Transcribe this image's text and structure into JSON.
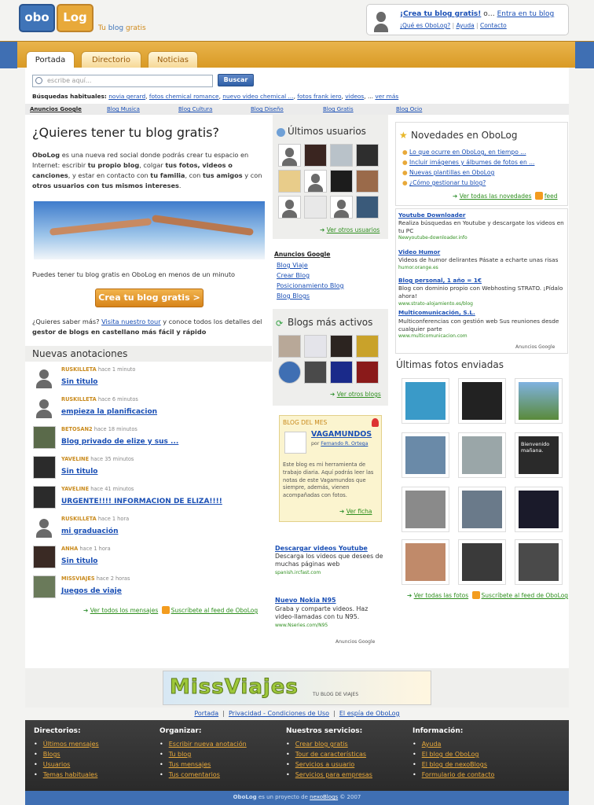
{
  "header": {
    "logo_left": "obo",
    "logo_right": "Log",
    "tagline_pre": "Tu ",
    "tagline_mid": "blog",
    "tagline_post": " gratis",
    "login": {
      "create": "¡Crea tu blog gratis!",
      "or": " o… ",
      "enter": "Entra en tu blog",
      "what": "¡Qué es OboLog?",
      "help": "Ayuda",
      "contact": "Contacto"
    }
  },
  "tabs": [
    "Portada",
    "Directorio",
    "Noticias"
  ],
  "search": {
    "placeholder": "escribe aquí...",
    "button": "Buscar",
    "label": "Búsquedas habituales:",
    "links": [
      "novia gerard",
      "fotos chemical romance",
      "nuevo video chemical ...",
      "fotos frank iero",
      "videos"
    ],
    "sep": ", ... ",
    "more": "ver más"
  },
  "adsbar": {
    "label": "Anuncios Google",
    "links": [
      "Blog Musica",
      "Blog Cultura",
      "Blog Diseño",
      "Blog Gratis",
      "Blog Ocio"
    ]
  },
  "intro": {
    "title": "¿Quieres tener tu blog gratis?",
    "p1a": "OboLog",
    "p1b": " es una nueva red social donde podrás crear tu espacio en Internet: escribir ",
    "p1c": "tu propio blog",
    "p1d": ", colgar ",
    "p1e": "tus fotos, videos o canciones",
    "p1f": ", y estar en contacto con ",
    "p1g": "tu familia",
    "p1h": ", con ",
    "p1i": "tus amigos",
    "p1j": " y con ",
    "p1k": "otros usuarios con tus mismos intereses",
    "p1l": ".",
    "p2": "Puedes tener tu blog gratis en OboLog en menos de un minuto",
    "cta": "Crea tu blog gratis >",
    "p3a": "¿Quieres saber más? ",
    "p3b": "Visita nuestro tour",
    "p3c": " y conoce todos los detalles del ",
    "p3d": "gestor de blogs en castellano más fácil y rápido"
  },
  "annotations": {
    "title": "Nuevas anotaciones",
    "items": [
      {
        "user": "RUSKILLETA",
        "time": "hace 1 minuto",
        "title": "Sin titulo"
      },
      {
        "user": "RUSKILLETA",
        "time": "hace 6 minutos",
        "title": "empieza la planificacion"
      },
      {
        "user": "BETOSAN2",
        "time": "hace 18 minutos",
        "title": "Blog privado de elize y sus ..."
      },
      {
        "user": "YAVELINE",
        "time": "hace 35 minutos",
        "title": "Sin titulo"
      },
      {
        "user": "YAVELINE",
        "time": "hace 41 minutos",
        "title": "URGENTE!!!! INFORMACION DE ELIZA!!!!"
      },
      {
        "user": "RUSKILLETA",
        "time": "hace 1 hora",
        "title": "mi graduación"
      },
      {
        "user": "ANHA",
        "time": "hace 1 hora",
        "title": "Sin titulo"
      },
      {
        "user": "MISSVIAJES",
        "time": "hace 2 horas",
        "title": "Juegos de viaje"
      }
    ],
    "all": "Ver todos los mensajes",
    "feed": "Suscríbete al feed de OboLog"
  },
  "users": {
    "title": "Últimos usuarios",
    "more": "Ver otros usuarios"
  },
  "ads_mid": {
    "label": "Anuncios Google",
    "links": [
      "Blog Viaje",
      "Crear Blog",
      "Posicionamiento Blog",
      "Blog Blogs"
    ]
  },
  "active": {
    "title": "Blogs más activos",
    "more": "Ver otros blogs"
  },
  "blog_del_mes": {
    "label": "BLOG DEL MES",
    "name": "VAGAMUNDOS",
    "by": "por ",
    "author": "Fernando R. Ortega",
    "desc": "Este blog es mi herramienta de trabajo diaria. Aquí podrás leer las notas de este Vagamundos que siempre, además, vienen acompañadas con fotos.",
    "link": "Ver ficha"
  },
  "ads_mid2": [
    {
      "title": "Descargar videos Youtube",
      "text": "Descarga los videos que desees de muchas páginas web",
      "url": "spanish.ircfast.com"
    },
    {
      "title": "Nuevo Nokia N95",
      "text": "Graba y comparte videos. Haz video-llamadas con tu N95.",
      "url": "www.Nseries.com/N95"
    }
  ],
  "google_badge": "Anuncios Google",
  "novedades": {
    "title": "Novedades en OboLog",
    "items": [
      "Lo que ocurre en OboLog, en tiempo ...",
      "Incluir imágenes y álbumes de fotos en ...",
      "Nuevas plantillas en OboLog",
      "¿Cómo gestionar tu blog?"
    ],
    "all": "Ver todas las novedades",
    "feed": "feed"
  },
  "ads_right": [
    {
      "title": "Youtube Downloader",
      "text": "Realiza búsquedas en Youtube y descargate los videos en tu PC",
      "url": "Newyoutube-downloader.info"
    },
    {
      "title": "Video Humor",
      "text": "Videos de humor delirantes Pásate a echarte unas risas",
      "url": "humor.orange.es"
    },
    {
      "title": "Blog personal, 1 año = 1€",
      "text": "Blog con dominio propio con Webhosting STRATO. ¡Pídalo ahora!",
      "url": "www.strato-alojamiento.es/blog"
    },
    {
      "title": "Multicomunicación, S.L.",
      "text": "Multiconferencias con gestión web Sus reuniones desde cualquier parte",
      "url": "www.multicomunicacion.com"
    }
  ],
  "photos": {
    "title": "Últimas fotos enviadas",
    "caption_bienvenido": "Bienvenido mañana.",
    "all": "Ver todas las fotos",
    "feed": "Suscríbete al feed de OboLog"
  },
  "banner": {
    "main": "MissViajes",
    "sub": "TU BLOG DE VIAJES"
  },
  "footer_links": [
    "Portada",
    "Privacidad - Condiciones de Uso",
    "El espía de OboLog"
  ],
  "footer": [
    {
      "title": "Directorios:",
      "items": [
        "Últimos mensajes",
        "Blogs",
        "Usuarios",
        "Temas habituales"
      ]
    },
    {
      "title": "Organizar:",
      "items": [
        "Escribir nueva anotación",
        "Tu blog",
        "Tus mensajes",
        "Tus comentarios"
      ]
    },
    {
      "title": "Nuestros servicios:",
      "items": [
        "Crear blog gratis",
        "Tour de características",
        "Servicios a usuario",
        "Servicios para empresas"
      ]
    },
    {
      "title": "Información:",
      "items": [
        "Ayuda",
        "El blog de OboLog",
        "El blog de nexoBlogs",
        "Formulario de contacto"
      ]
    }
  ],
  "bottom": {
    "a": "OboLog",
    "b": " es un proyecto de ",
    "c": "nexoBlogs",
    "d": " © 2007"
  }
}
